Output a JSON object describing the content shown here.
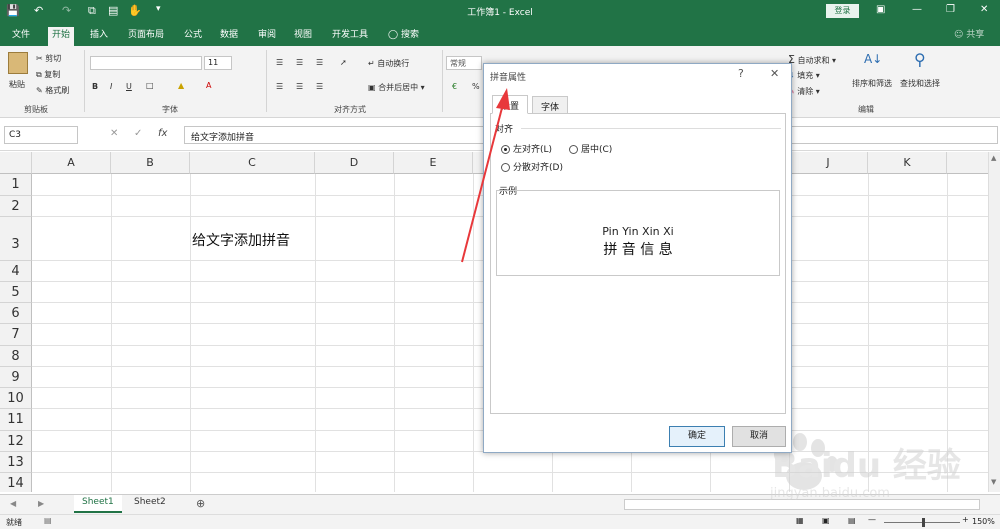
{
  "app": {
    "window_title": "工作簿1 - Excel",
    "login": "登录",
    "share": "共享"
  },
  "tabs": [
    {
      "label": "文件"
    },
    {
      "label": "开始"
    },
    {
      "label": "插入"
    },
    {
      "label": "页面布局"
    },
    {
      "label": "公式"
    },
    {
      "label": "数据"
    },
    {
      "label": "审阅"
    },
    {
      "label": "视图"
    },
    {
      "label": "开发工具"
    },
    {
      "label": "搜索"
    }
  ],
  "ribbon": {
    "clipboard": {
      "paste": "粘贴",
      "cut": "剪切",
      "copy": "复制",
      "format_painter": "格式刷",
      "group": "剪贴板"
    },
    "font": {
      "font_size": "11",
      "group": "字体"
    },
    "alignment": {
      "wrap": "自动换行",
      "merge": "合并后居中",
      "group": "对齐方式"
    },
    "number": {
      "format": "常规"
    },
    "editing": {
      "autosum": "自动求和",
      "fill": "填充",
      "clear": "清除",
      "sort": "排序和筛选",
      "find": "查找和选择",
      "group": "编辑"
    }
  },
  "formula_bar": {
    "name_box": "C3",
    "fx": "fx",
    "content": "给文字添加拼音"
  },
  "grid": {
    "columns": [
      "A",
      "B",
      "C",
      "D",
      "E",
      "F",
      "G",
      "H",
      "I",
      "J",
      "K"
    ],
    "rows": [
      "1",
      "2",
      "3",
      "4",
      "5",
      "6",
      "7",
      "8",
      "9",
      "10",
      "11",
      "12",
      "13",
      "14"
    ],
    "c3_text": "给文字添加拼音"
  },
  "sheets": {
    "tabs": [
      "Sheet1",
      "Sheet2"
    ],
    "active": "Sheet1"
  },
  "status": {
    "ready": "就绪",
    "zoom": "150%"
  },
  "dialog": {
    "title": "拼音属性",
    "help": "?",
    "tabs": [
      "设置",
      "字体"
    ],
    "align_label": "对齐",
    "options": [
      "左对齐(L)",
      "居中(C)",
      "分散对齐(D)"
    ],
    "sample_label": "示例",
    "sample_pinyin": "Pin Yin Xin Xi",
    "sample_chars": "拼 音 信 息",
    "ok": "确定",
    "cancel": "取消"
  },
  "watermark": {
    "brand": "Baidu 经验",
    "url": "jingyan.baidu.com"
  },
  "colors": {
    "excel_green": "#217346",
    "arrow_red": "#e8383b"
  }
}
